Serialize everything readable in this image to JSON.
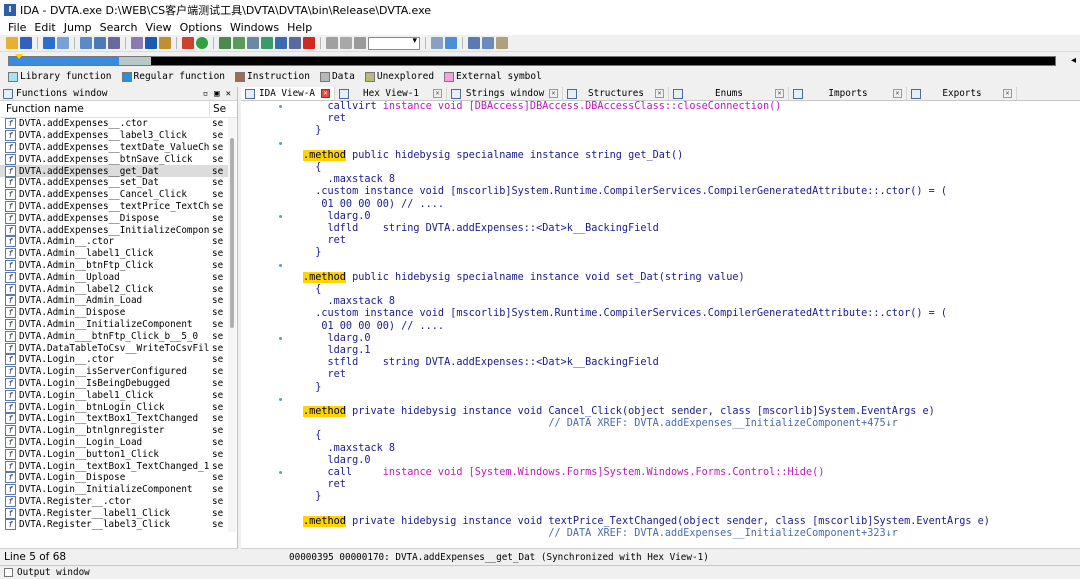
{
  "title": "IDA - DVTA.exe D:\\WEB\\CS客户端测试工具\\DVTA\\DVTA\\bin\\Release\\DVTA.exe",
  "menu": [
    "File",
    "Edit",
    "Jump",
    "Search",
    "View",
    "Options",
    "Windows",
    "Help"
  ],
  "legend": [
    {
      "label": "Library function",
      "color": "#a8e0f8"
    },
    {
      "label": "Regular function",
      "color": "#2b8fe0"
    },
    {
      "label": "Instruction",
      "color": "#a06a55"
    },
    {
      "label": "Data",
      "color": "#b8b8b8"
    },
    {
      "label": "Unexplored",
      "color": "#b8b880"
    },
    {
      "label": "External symbol",
      "color": "#f8a0e0"
    }
  ],
  "functions_window": {
    "title": "Functions window",
    "col_name": "Function name",
    "col_seg": "Se",
    "status": "Line 5 of 68",
    "rows": [
      {
        "name": "DVTA.addExpenses__.ctor",
        "seg": "se"
      },
      {
        "name": "DVTA.addExpenses__label3_Click",
        "seg": "se"
      },
      {
        "name": "DVTA.addExpenses__textDate_ValueCha···",
        "seg": "se"
      },
      {
        "name": "DVTA.addExpenses__btnSave_Click",
        "seg": "se"
      },
      {
        "name": "DVTA.addExpenses__get_Dat",
        "seg": "se"
      },
      {
        "name": "DVTA.addExpenses__set_Dat",
        "seg": "se"
      },
      {
        "name": "DVTA.addExpenses__Cancel_Click",
        "seg": "se"
      },
      {
        "name": "DVTA.addExpenses__textPrice_TextCha···",
        "seg": "se"
      },
      {
        "name": "DVTA.addExpenses__Dispose",
        "seg": "se"
      },
      {
        "name": "DVTA.addExpenses__InitializeComponent",
        "seg": "se"
      },
      {
        "name": "DVTA.Admin__.ctor",
        "seg": "se"
      },
      {
        "name": "DVTA.Admin__label1_Click",
        "seg": "se"
      },
      {
        "name": "DVTA.Admin__btnFtp_Click",
        "seg": "se"
      },
      {
        "name": "DVTA.Admin__Upload",
        "seg": "se"
      },
      {
        "name": "DVTA.Admin__label2_Click",
        "seg": "se"
      },
      {
        "name": "DVTA.Admin__Admin_Load",
        "seg": "se"
      },
      {
        "name": "DVTA.Admin__Dispose",
        "seg": "se"
      },
      {
        "name": "DVTA.Admin__InitializeComponent",
        "seg": "se"
      },
      {
        "name": "DVTA.Admin___btnFtp_Click_b__5_0",
        "seg": "se"
      },
      {
        "name": "DVTA.DataTableToCsv__WriteToCsvFile",
        "seg": "se"
      },
      {
        "name": "DVTA.Login__.ctor",
        "seg": "se"
      },
      {
        "name": "DVTA.Login__isServerConfigured",
        "seg": "se"
      },
      {
        "name": "DVTA.Login__IsBeingDebugged",
        "seg": "se"
      },
      {
        "name": "DVTA.Login__label1_Click",
        "seg": "se"
      },
      {
        "name": "DVTA.Login__btnLogin_Click",
        "seg": "se"
      },
      {
        "name": "DVTA.Login__textBox1_TextChanged",
        "seg": "se"
      },
      {
        "name": "DVTA.Login__btnlgnregister",
        "seg": "se"
      },
      {
        "name": "DVTA.Login__Login_Load",
        "seg": "se"
      },
      {
        "name": "DVTA.Login__button1_Click",
        "seg": "se"
      },
      {
        "name": "DVTA.Login__textBox1_TextChanged_1",
        "seg": "se"
      },
      {
        "name": "DVTA.Login__Dispose",
        "seg": "se"
      },
      {
        "name": "DVTA.Login__InitializeComponent",
        "seg": "se"
      },
      {
        "name": "DVTA.Register__.ctor",
        "seg": "se"
      },
      {
        "name": "DVTA.Register__label1_Click",
        "seg": "se"
      },
      {
        "name": "DVTA.Register__label3_Click",
        "seg": "se"
      }
    ]
  },
  "tabs": [
    {
      "label": "IDA View-A",
      "active": true
    },
    {
      "label": "Hex View-1",
      "active": false
    },
    {
      "label": "Strings window",
      "active": false
    },
    {
      "label": "Structures",
      "active": false
    },
    {
      "label": "Enums",
      "active": false
    },
    {
      "label": "Imports",
      "active": false
    },
    {
      "label": "Exports",
      "active": false
    }
  ],
  "code": [
    {
      "t": [
        [
          "    callvirt ",
          ""
        ],
        [
          "instance void [DBAccess]DBAccess.DBAccessClass::closeConnection()",
          "mag"
        ]
      ]
    },
    {
      "t": [
        [
          "    ret",
          ""
        ]
      ]
    },
    {
      "t": [
        [
          "  }",
          ""
        ]
      ]
    },
    {
      "t": [
        [
          "",
          ""
        ]
      ]
    },
    {
      "t": [
        [
          ".method",
          "mth"
        ],
        [
          " public hidebysig specialname instance string get_Dat()",
          ""
        ]
      ]
    },
    {
      "t": [
        [
          "  {",
          ""
        ]
      ]
    },
    {
      "t": [
        [
          "    .maxstack 8",
          ""
        ]
      ]
    },
    {
      "t": [
        [
          "  .custom instance void [mscorlib]System.Runtime.CompilerServices.CompilerGeneratedAttribute::.ctor() = (",
          ""
        ]
      ]
    },
    {
      "t": [
        [
          "   01 00 00 00) // ....",
          ""
        ]
      ]
    },
    {
      "t": [
        [
          "    ldarg.0",
          ""
        ]
      ]
    },
    {
      "t": [
        [
          "    ldfld    string DVTA.addExpenses::<Dat>k__BackingField",
          ""
        ]
      ]
    },
    {
      "t": [
        [
          "    ret",
          ""
        ]
      ]
    },
    {
      "t": [
        [
          "  }",
          ""
        ]
      ]
    },
    {
      "t": [
        [
          "",
          ""
        ]
      ]
    },
    {
      "t": [
        [
          ".method",
          "mth"
        ],
        [
          " public hidebysig specialname instance void set_Dat(string value)",
          ""
        ]
      ]
    },
    {
      "t": [
        [
          "  {",
          ""
        ]
      ]
    },
    {
      "t": [
        [
          "    .maxstack 8",
          ""
        ]
      ]
    },
    {
      "t": [
        [
          "  .custom instance void [mscorlib]System.Runtime.CompilerServices.CompilerGeneratedAttribute::.ctor() = (",
          ""
        ]
      ]
    },
    {
      "t": [
        [
          "   01 00 00 00) // ....",
          ""
        ]
      ]
    },
    {
      "t": [
        [
          "    ldarg.0",
          ""
        ]
      ]
    },
    {
      "t": [
        [
          "    ldarg.1",
          ""
        ]
      ]
    },
    {
      "t": [
        [
          "    stfld    string DVTA.addExpenses::<Dat>k__BackingField",
          ""
        ]
      ]
    },
    {
      "t": [
        [
          "    ret",
          ""
        ]
      ]
    },
    {
      "t": [
        [
          "  }",
          ""
        ]
      ]
    },
    {
      "t": [
        [
          "",
          ""
        ]
      ]
    },
    {
      "t": [
        [
          ".method",
          "mth"
        ],
        [
          " private hidebysig instance void Cancel_Click(object sender, class [mscorlib]System.EventArgs e)",
          ""
        ]
      ]
    },
    {
      "t": [
        [
          "                                        // DATA XREF: DVTA.addExpenses__InitializeComponent+475↓r",
          "cm"
        ]
      ]
    },
    {
      "t": [
        [
          "  {",
          ""
        ]
      ]
    },
    {
      "t": [
        [
          "    .maxstack 8",
          ""
        ]
      ]
    },
    {
      "t": [
        [
          "    ldarg.0",
          ""
        ]
      ]
    },
    {
      "t": [
        [
          "    call     ",
          ""
        ],
        [
          "instance void [System.Windows.Forms]System.Windows.Forms.Control::Hide()",
          "mag"
        ]
      ]
    },
    {
      "t": [
        [
          "    ret",
          ""
        ]
      ]
    },
    {
      "t": [
        [
          "  }",
          ""
        ]
      ]
    },
    {
      "t": [
        [
          "",
          ""
        ]
      ]
    },
    {
      "t": [
        [
          ".method",
          "mth"
        ],
        [
          " private hidebysig instance void textPrice_TextChanged(object sender, class [mscorlib]System.EventArgs e)",
          ""
        ]
      ]
    },
    {
      "t": [
        [
          "                                        // DATA XREF: DVTA.addExpenses__InitializeComponent+323↓r",
          "cm"
        ]
      ]
    }
  ],
  "view_status": "00000395 00000170: DVTA.addExpenses__get_Dat (Synchronized with Hex View-1)",
  "output_title": "Output window"
}
